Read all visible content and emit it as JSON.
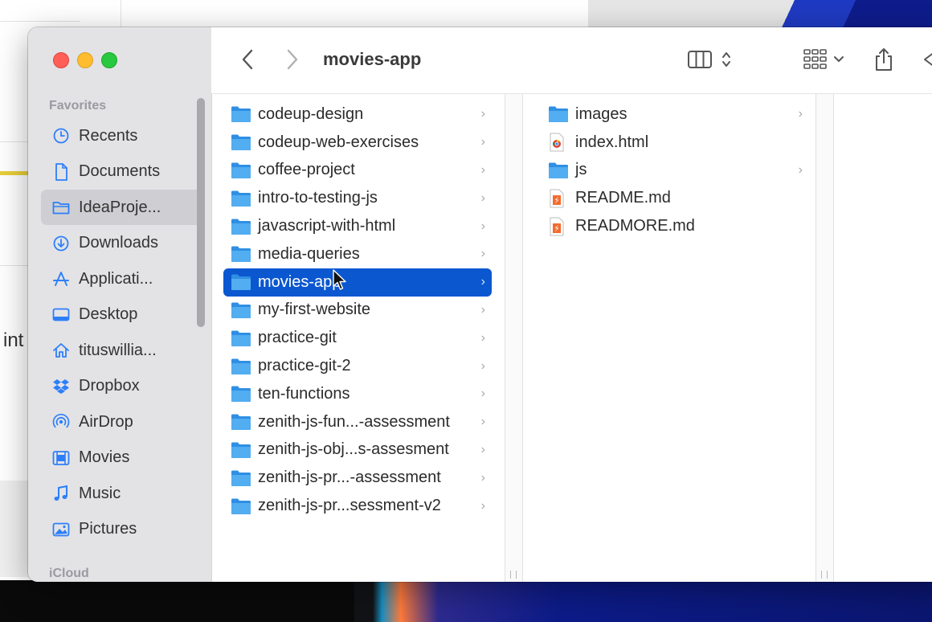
{
  "window_title": "movies-app",
  "sidebar": {
    "favorites_title": "Favorites",
    "items": [
      {
        "label": "Recents",
        "icon": "clock-icon",
        "selected": false
      },
      {
        "label": "Documents",
        "icon": "document-icon",
        "selected": false
      },
      {
        "label": "IdeaProje...",
        "icon": "folder-icon",
        "selected": true
      },
      {
        "label": "Downloads",
        "icon": "download-icon",
        "selected": false
      },
      {
        "label": "Applicati...",
        "icon": "applications-icon",
        "selected": false
      },
      {
        "label": "Desktop",
        "icon": "desktop-icon",
        "selected": false
      },
      {
        "label": "tituswillia...",
        "icon": "home-icon",
        "selected": false
      },
      {
        "label": "Dropbox",
        "icon": "dropbox-icon",
        "selected": false
      },
      {
        "label": "AirDrop",
        "icon": "airdrop-icon",
        "selected": false
      },
      {
        "label": "Movies",
        "icon": "film-icon",
        "selected": false
      },
      {
        "label": "Music",
        "icon": "music-note-icon",
        "selected": false
      },
      {
        "label": "Pictures",
        "icon": "photo-icon",
        "selected": false
      }
    ],
    "icloud_title": "iCloud"
  },
  "toolbar": {
    "back_icon": "chevron-left-icon",
    "forward_icon": "chevron-right-icon",
    "view_icon": "column-view-icon",
    "group_icon": "grid-group-icon",
    "share_icon": "share-icon"
  },
  "column1": [
    {
      "name": "codeup-design",
      "type": "folder",
      "selected": false
    },
    {
      "name": "codeup-web-exercises",
      "type": "folder",
      "selected": false
    },
    {
      "name": "coffee-project",
      "type": "folder",
      "selected": false
    },
    {
      "name": "intro-to-testing-js",
      "type": "folder",
      "selected": false
    },
    {
      "name": "javascript-with-html",
      "type": "folder",
      "selected": false
    },
    {
      "name": "media-queries",
      "type": "folder",
      "selected": false
    },
    {
      "name": "movies-app",
      "type": "folder",
      "selected": true
    },
    {
      "name": "my-first-website",
      "type": "folder",
      "selected": false
    },
    {
      "name": "practice-git",
      "type": "folder",
      "selected": false
    },
    {
      "name": "practice-git-2",
      "type": "folder",
      "selected": false
    },
    {
      "name": "ten-functions",
      "type": "folder",
      "selected": false
    },
    {
      "name": "zenith-js-fun...-assessment",
      "type": "folder",
      "selected": false
    },
    {
      "name": "zenith-js-obj...s-assesment",
      "type": "folder",
      "selected": false
    },
    {
      "name": "zenith-js-pr...-assessment",
      "type": "folder",
      "selected": false
    },
    {
      "name": "zenith-js-pr...sessment-v2",
      "type": "folder",
      "selected": false
    }
  ],
  "column2": [
    {
      "name": "images",
      "type": "folder"
    },
    {
      "name": "index.html",
      "type": "html"
    },
    {
      "name": "js",
      "type": "folder"
    },
    {
      "name": "README.md",
      "type": "markdown"
    },
    {
      "name": "READMORE.md",
      "type": "markdown"
    }
  ],
  "background": {
    "partial_text": "int"
  },
  "colors": {
    "selection": "#0b57d0",
    "folder": "#3a9bea",
    "sidebar_icon": "#2d7ff9",
    "sidebar_bg": "#e3e3e6"
  }
}
